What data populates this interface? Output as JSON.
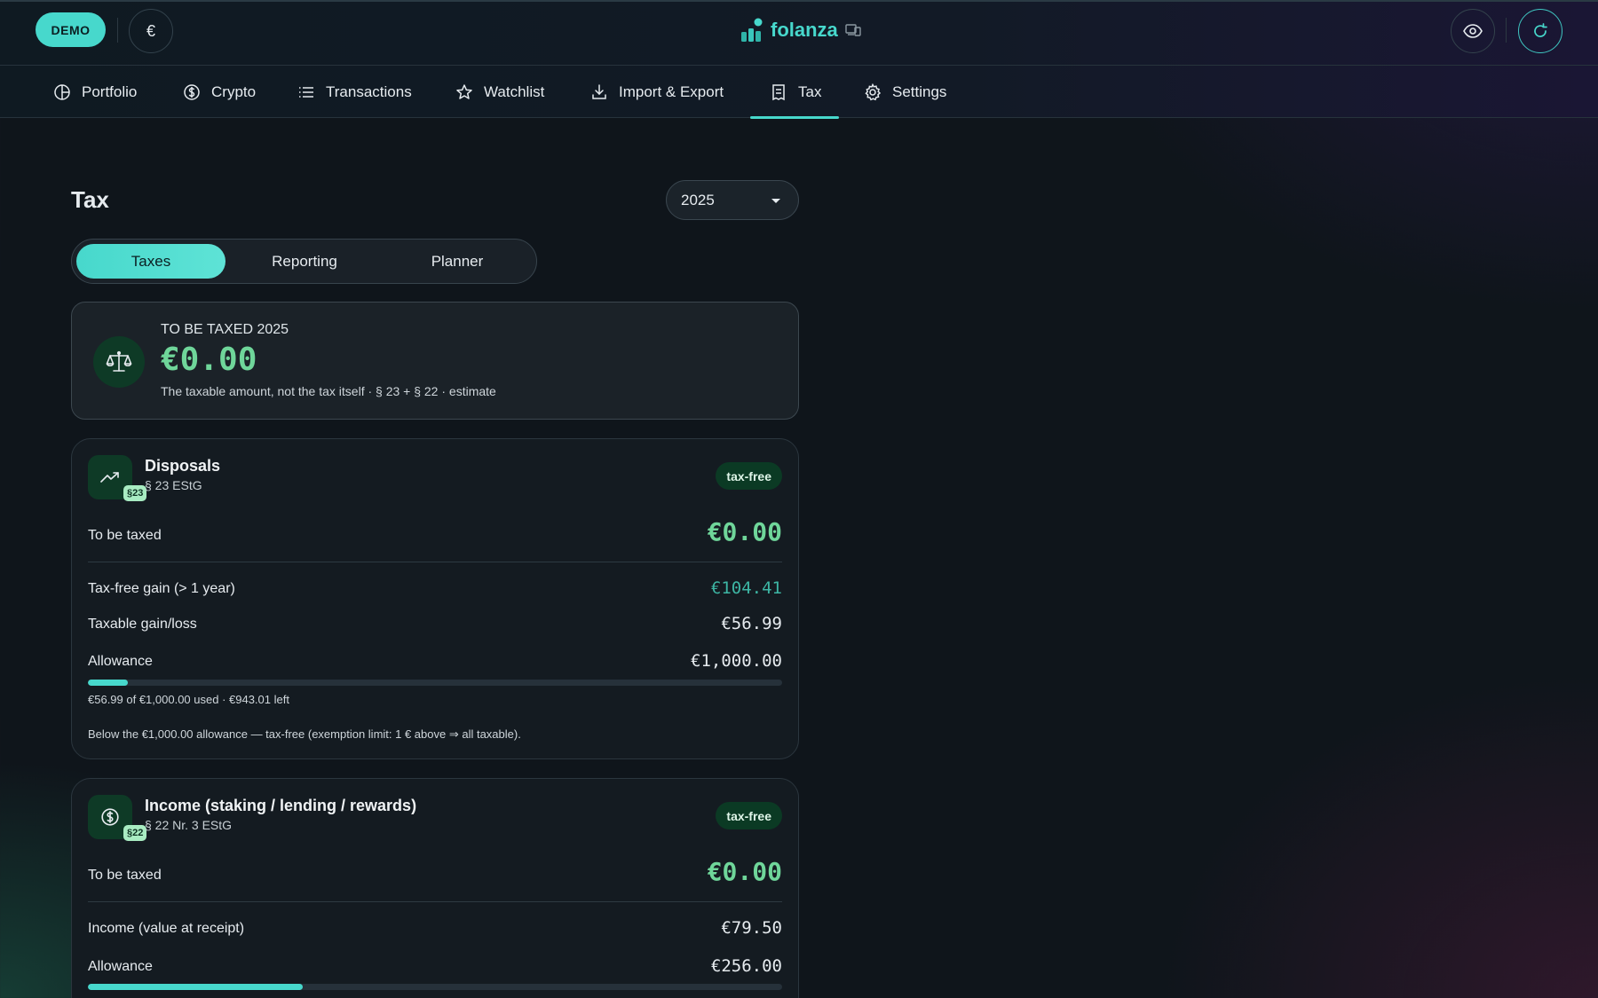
{
  "header": {
    "demo_label": "DEMO",
    "currency_symbol": "€",
    "brand_name": "folanza"
  },
  "nav": {
    "items": [
      {
        "label": "Portfolio",
        "icon": "pie-chart-icon"
      },
      {
        "label": "Crypto",
        "icon": "coin-icon"
      },
      {
        "label": "Transactions",
        "icon": "list-icon"
      },
      {
        "label": "Watchlist",
        "icon": "star-icon"
      },
      {
        "label": "Import & Export",
        "icon": "download-icon"
      },
      {
        "label": "Tax",
        "icon": "receipt-icon"
      },
      {
        "label": "Settings",
        "icon": "gear-icon"
      }
    ],
    "active": "Tax"
  },
  "page": {
    "title": "Tax",
    "year": "2025",
    "tabs": [
      "Taxes",
      "Reporting",
      "Planner"
    ],
    "active_tab": "Taxes"
  },
  "summary": {
    "label": "TO BE TAXED 2025",
    "value": "€0.00",
    "note": "The taxable amount, not the tax itself · § 23 + § 22 · estimate"
  },
  "disposals": {
    "title": "Disposals",
    "subtitle": "§ 23 EStG",
    "badge": "§23",
    "status": "tax-free",
    "to_be_taxed_label": "To be taxed",
    "to_be_taxed_value": "€0.00",
    "taxfree_gain_label": "Tax-free gain (> 1 year)",
    "taxfree_gain_value": "€104.41",
    "taxable_label": "Taxable gain/loss",
    "taxable_value": "€56.99",
    "allowance_label": "Allowance",
    "allowance_value": "€1,000.00",
    "allowance_used_fraction": 0.057,
    "usage_text": "€56.99 of €1,000.00 used · €943.01 left",
    "note": "Below the €1,000.00 allowance — tax-free (exemption limit: 1 € above ⇒ all taxable)."
  },
  "income": {
    "title": "Income (staking / lending / rewards)",
    "subtitle": "§ 22 Nr. 3 EStG",
    "badge": "§22",
    "status": "tax-free",
    "to_be_taxed_label": "To be taxed",
    "to_be_taxed_value": "€0.00",
    "income_label": "Income (value at receipt)",
    "income_value": "€79.50",
    "allowance_label": "Allowance",
    "allowance_value": "€256.00",
    "allowance_used_fraction": 0.31
  },
  "colors": {
    "accent": "#47d8cc",
    "positive": "#6fd69a",
    "teal_value": "#3db6a4",
    "badge_bg": "#0b3a24"
  }
}
